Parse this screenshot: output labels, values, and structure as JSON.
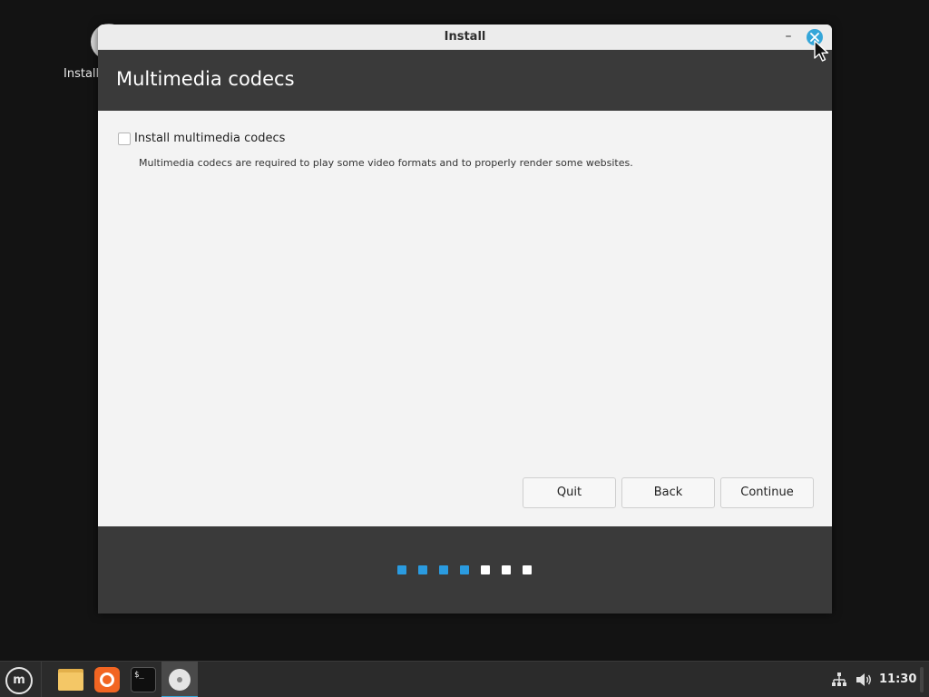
{
  "desktop": {
    "icons": [
      {
        "label": "Install",
        "icon": "installer-disc-icon"
      }
    ]
  },
  "window": {
    "title": "Install",
    "minimize_label": "–",
    "close_icon": "close-icon",
    "accent": "#35a6d9",
    "header": {
      "title": "Multimedia codecs"
    },
    "option": {
      "label": "Install multimedia codecs",
      "checked": false,
      "description": "Multimedia codecs are required to play some video formats and to properly render some websites."
    },
    "buttons": {
      "quit": "Quit",
      "back": "Back",
      "continue": "Continue"
    },
    "progress": {
      "total_steps": 7,
      "completed_steps": 4,
      "done_color": "#2a9be0",
      "todo_color": "#ffffff"
    }
  },
  "taskbar": {
    "launchers": [
      {
        "name": "menu",
        "icon": "mint-menu-icon"
      },
      {
        "name": "files",
        "icon": "folder-icon"
      },
      {
        "name": "firefox",
        "icon": "firefox-icon"
      },
      {
        "name": "terminal",
        "icon": "terminal-icon",
        "glyph": "$_"
      },
      {
        "name": "installer",
        "icon": "installer-disc-icon",
        "active": true
      }
    ],
    "tray": {
      "network_icon": "network-icon",
      "volume_icon": "volume-icon"
    },
    "clock": "11:30"
  }
}
